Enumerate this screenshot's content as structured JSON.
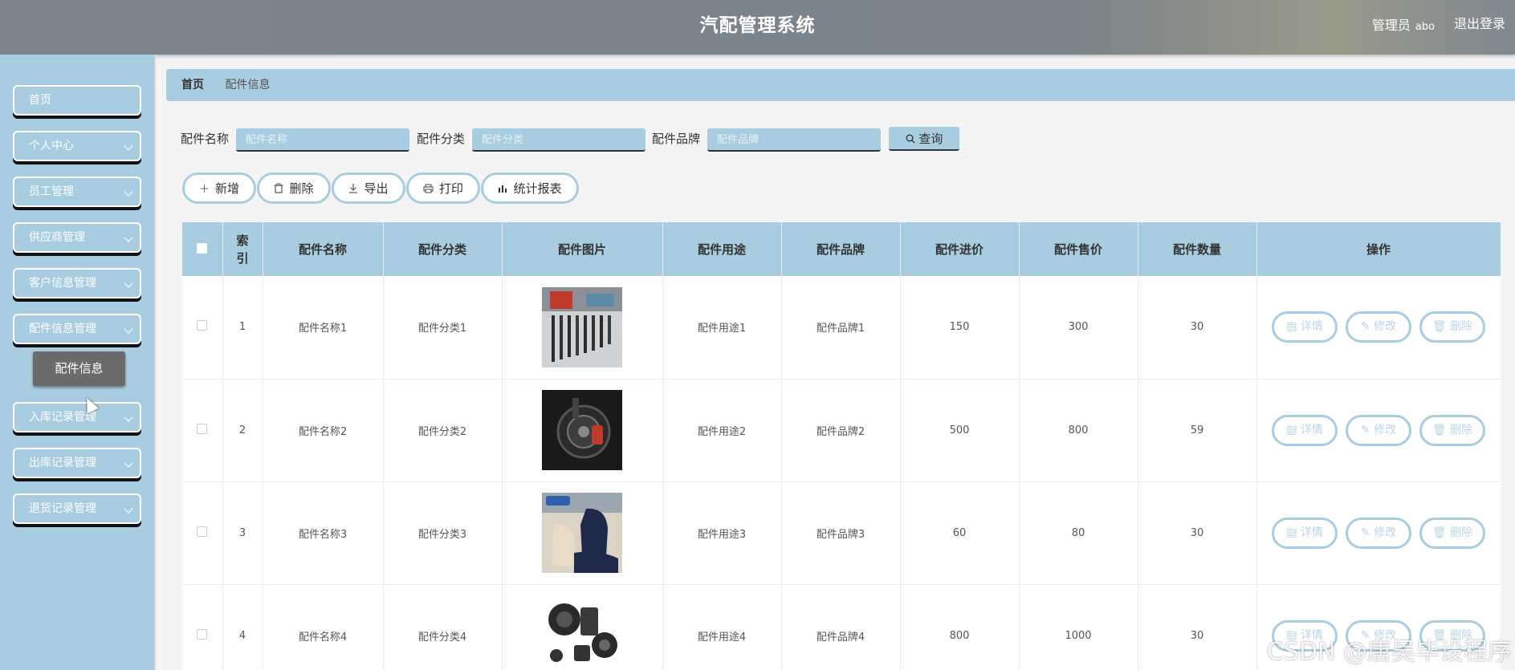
{
  "header": {
    "title": "汽配管理系统",
    "user_role": "管理员",
    "user_name": "abo",
    "logout": "退出登录"
  },
  "sidebar": {
    "items": [
      {
        "label": "首页",
        "has_arrow": false
      },
      {
        "label": "个人中心",
        "has_arrow": true
      },
      {
        "label": "员工管理",
        "has_arrow": true
      },
      {
        "label": "供应商管理",
        "has_arrow": true
      },
      {
        "label": "客户信息管理",
        "has_arrow": true
      },
      {
        "label": "配件信息管理",
        "has_arrow": true
      },
      {
        "label": "入库记录管理",
        "has_arrow": true
      },
      {
        "label": "出库记录管理",
        "has_arrow": true
      },
      {
        "label": "退货记录管理",
        "has_arrow": true
      }
    ],
    "submenu": {
      "label": "配件信息"
    }
  },
  "breadcrumb": {
    "home": "首页",
    "current": "配件信息"
  },
  "search": {
    "name_label": "配件名称",
    "name_placeholder": "配件名称",
    "category_label": "配件分类",
    "category_placeholder": "配件分类",
    "brand_label": "配件品牌",
    "brand_placeholder": "配件品牌",
    "button": "查询"
  },
  "toolbar": {
    "add": "新增",
    "delete": "删除",
    "export": "导出",
    "print": "打印",
    "report": "统计报表"
  },
  "table": {
    "headers": {
      "index": "索引",
      "name": "配件名称",
      "category": "配件分类",
      "image": "配件图片",
      "usage": "配件用途",
      "brand": "配件品牌",
      "cost": "配件进价",
      "price": "配件售价",
      "quantity": "配件数量",
      "actions": "操作"
    },
    "actions": {
      "detail": "详情",
      "edit": "修改",
      "delete": "删除"
    },
    "rows": [
      {
        "index": "1",
        "name": "配件名称1",
        "category": "配件分类1",
        "image": "tools-image",
        "usage": "配件用途1",
        "brand": "配件品牌1",
        "cost": "150",
        "price": "300",
        "quantity": "30"
      },
      {
        "index": "2",
        "name": "配件名称2",
        "category": "配件分类2",
        "image": "brake-image",
        "usage": "配件用途2",
        "brand": "配件品牌2",
        "cost": "500",
        "price": "800",
        "quantity": "59"
      },
      {
        "index": "3",
        "name": "配件名称3",
        "category": "配件分类3",
        "image": "seat-image",
        "usage": "配件用途3",
        "brand": "配件品牌3",
        "cost": "60",
        "price": "80",
        "quantity": "30"
      },
      {
        "index": "4",
        "name": "配件名称4",
        "category": "配件分类4",
        "image": "speaker-image",
        "usage": "配件用途4",
        "brand": "配件品牌4",
        "cost": "800",
        "price": "1000",
        "quantity": "30"
      }
    ]
  },
  "watermark": "CSDN @唐吴毕设程序",
  "colors": {
    "accent": "#a8cde0",
    "header": "#7c858d",
    "submenu_active": "#6b6b6b"
  }
}
